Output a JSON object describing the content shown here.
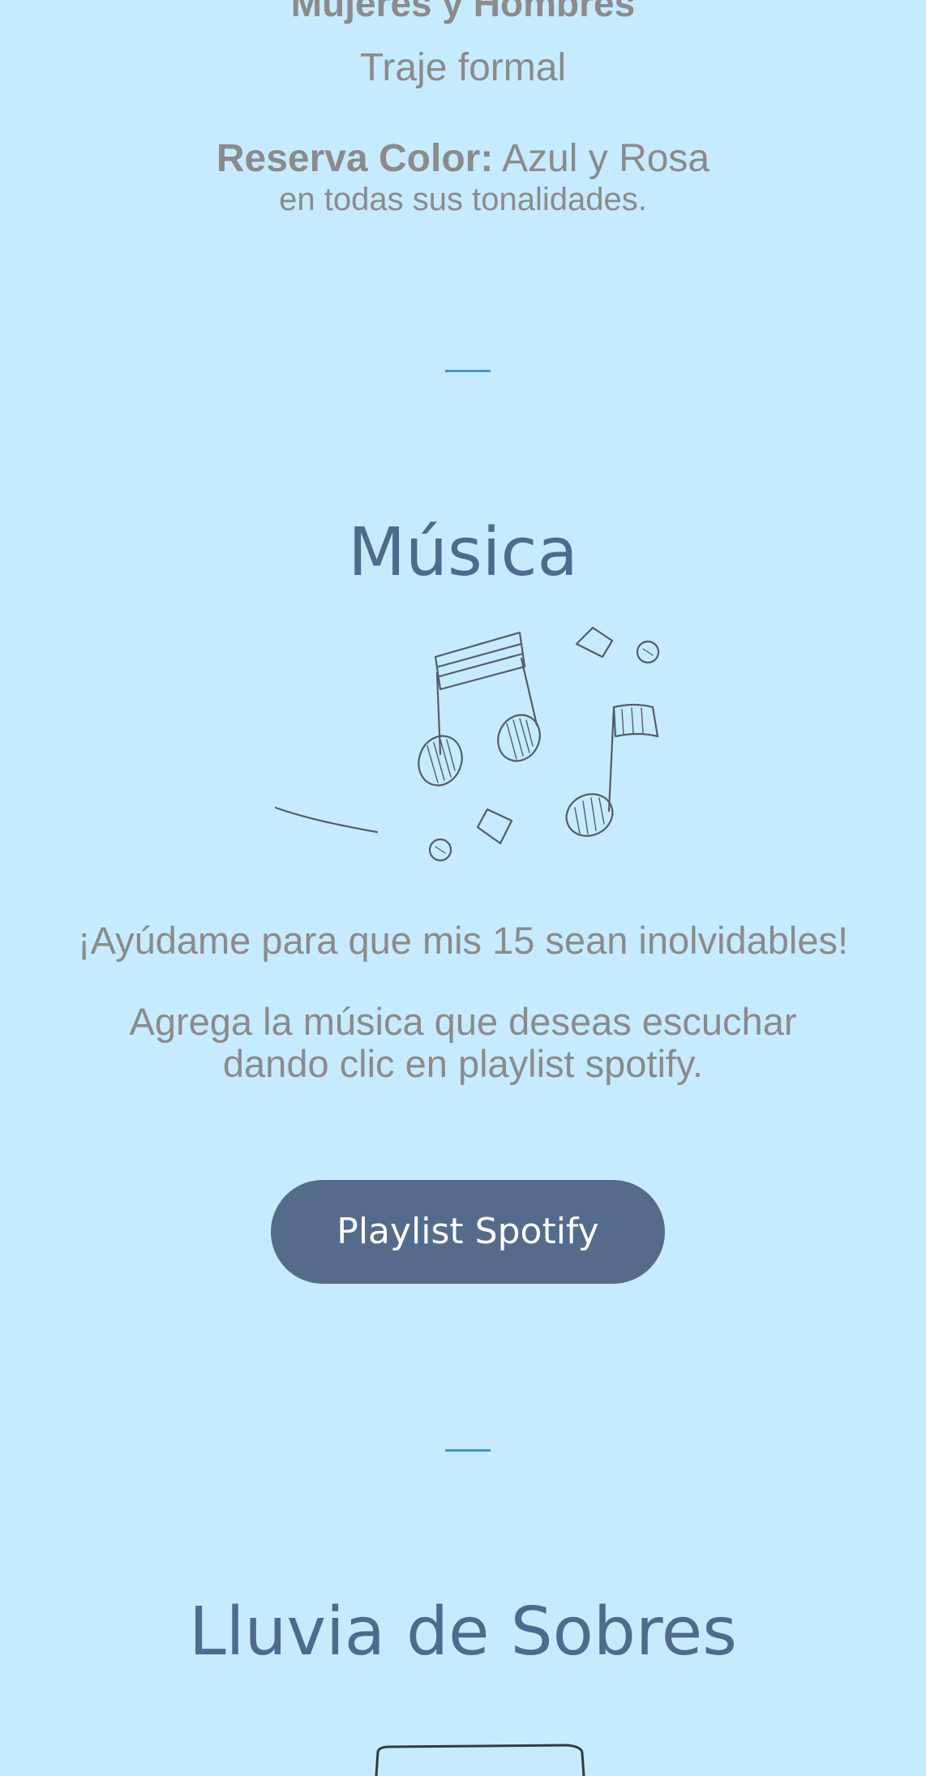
{
  "dress_code": {
    "title": "Mujeres y Hombres",
    "subtitle": "Traje formal",
    "reserve_label": "Reserva Color:",
    "reserve_value": " Azul y Rosa",
    "reserve_line2": "en todas sus tonalidades."
  },
  "music": {
    "title": "Música",
    "illustration_icon": "music-notes-sketch-icon",
    "help_text": "¡Ayúdame para que mis 15 sean inolvidables!",
    "add_text_line1": "Agrega la música que deseas escuchar",
    "add_text_line2": "dando clic en playlist spotify.",
    "button_label": "Playlist Spotify"
  },
  "envelopes": {
    "title": "Lluvia de Sobres",
    "illustration_icon": "envelope-sketch-icon"
  },
  "colors": {
    "background": "#c6ebfe",
    "accent": "#546b8c",
    "heading": "#4e6a8f",
    "divider": "#4a8fd8",
    "body_text": "#8b8b8b"
  }
}
